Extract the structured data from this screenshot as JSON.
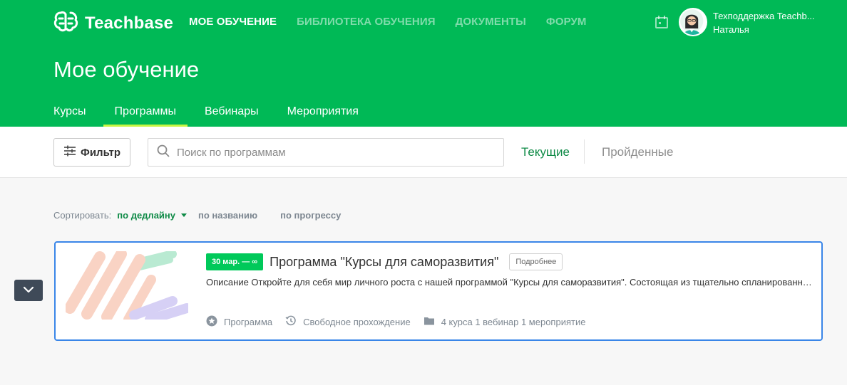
{
  "header": {
    "brand": "Teachbase",
    "nav": [
      {
        "label": "Мое обучение",
        "active": true
      },
      {
        "label": "Библиотека обучения",
        "active": false
      },
      {
        "label": "Документы",
        "active": false
      },
      {
        "label": "Форум",
        "active": false
      }
    ],
    "user_name": "Техподдержка Teachb...",
    "user_first_name": "Наталья",
    "colors": {
      "primary": "#00b956",
      "accent": "#c8f542"
    }
  },
  "page": {
    "title": "Мое обучение",
    "tabs": [
      {
        "label": "Курсы",
        "active": false
      },
      {
        "label": "Программы",
        "active": true
      },
      {
        "label": "Вебинары",
        "active": false
      },
      {
        "label": "Мероприятия",
        "active": false
      }
    ]
  },
  "toolbar": {
    "filter_label": "Фильтр",
    "search_placeholder": "Поиск по программам",
    "segment_current": "Текущие",
    "segment_done": "Пройденные"
  },
  "sort": {
    "label": "Сортировать:",
    "options": [
      {
        "label": "по дедлайну",
        "active": true
      },
      {
        "label": "по названию",
        "active": false
      },
      {
        "label": "по прогрессу",
        "active": false
      }
    ]
  },
  "card": {
    "date_badge": "30 мар. — ∞",
    "title": "Программа \"Курсы для саморазвития\"",
    "details_label": "Подробнее",
    "description": "Описание Откройте для себя мир личного роста с нашей программой \"Курсы для саморазвития\". Состоящая из тщательно спланированных курсов",
    "meta": {
      "type": "Программа",
      "mode": "Свободное прохождение",
      "contents": "4 курса 1 вебинар 1 мероприятие"
    }
  },
  "icons": {
    "logo": "brain-logo-icon",
    "calendar": "calendar-icon",
    "filter": "sliders-icon",
    "search": "search-icon",
    "collapse": "chevron-down-icon",
    "type": "star-icon",
    "mode": "history-icon",
    "contents": "folder-icon"
  }
}
